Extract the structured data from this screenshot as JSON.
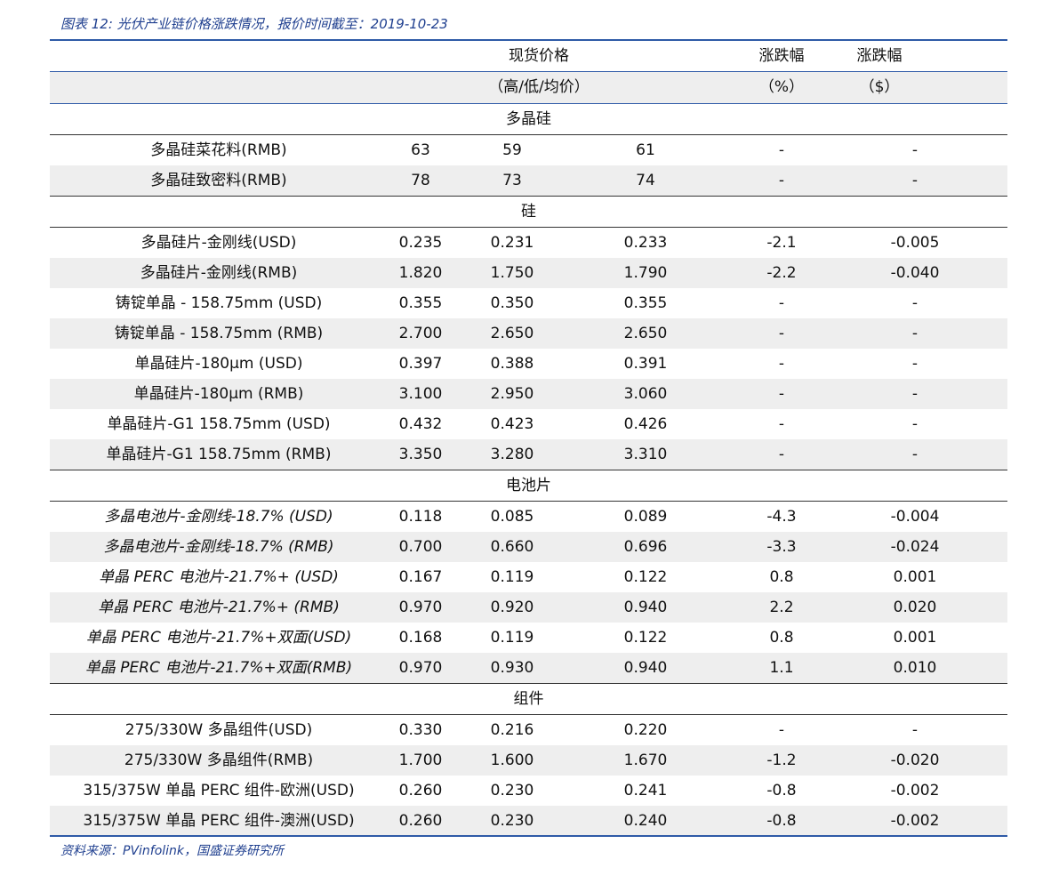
{
  "caption": "图表 12: 光伏产业链价格涨跌情况，报价时间截至：2019-10-23",
  "header": {
    "spot_price": "现货价格",
    "change1": "涨跌幅",
    "change2": "涨跌幅",
    "hl_avg": "（高/低/均价）",
    "pct": "（%）",
    "usd": "（$）"
  },
  "groups": [
    {
      "title": "多晶硅",
      "italic": false,
      "rows": [
        {
          "name": "多晶硅菜花料(RMB)",
          "high": "63",
          "low": "59",
          "avg": "61",
          "pct": "-",
          "abs": "-"
        },
        {
          "name": "多晶硅致密料(RMB)",
          "high": "78",
          "low": "73",
          "avg": "74",
          "pct": "-",
          "abs": "-"
        }
      ]
    },
    {
      "title": "硅",
      "italic": false,
      "rows": [
        {
          "name": "多晶硅片-金刚线(USD)",
          "high": "0.235",
          "low": "0.231",
          "avg": "0.233",
          "pct": "-2.1",
          "abs": "-0.005"
        },
        {
          "name": "多晶硅片-金刚线(RMB)",
          "high": "1.820",
          "low": "1.750",
          "avg": "1.790",
          "pct": "-2.2",
          "abs": "-0.040"
        },
        {
          "name": "铸锭单晶 - 158.75mm (USD)",
          "high": "0.355",
          "low": "0.350",
          "avg": "0.355",
          "pct": "-",
          "abs": "-"
        },
        {
          "name": "铸锭单晶 - 158.75mm (RMB)",
          "high": "2.700",
          "low": "2.650",
          "avg": "2.650",
          "pct": "-",
          "abs": "-"
        },
        {
          "name": "单晶硅片-180μm (USD)",
          "high": "0.397",
          "low": "0.388",
          "avg": "0.391",
          "pct": "-",
          "abs": "-"
        },
        {
          "name": "单晶硅片-180μm (RMB)",
          "high": "3.100",
          "low": "2.950",
          "avg": "3.060",
          "pct": "-",
          "abs": "-"
        },
        {
          "name": "单晶硅片-G1 158.75mm (USD)",
          "high": "0.432",
          "low": "0.423",
          "avg": "0.426",
          "pct": "-",
          "abs": "-"
        },
        {
          "name": "单晶硅片-G1 158.75mm (RMB)",
          "high": "3.350",
          "low": "3.280",
          "avg": "3.310",
          "pct": "-",
          "abs": "-"
        }
      ]
    },
    {
      "title": "电池片",
      "italic": true,
      "rows": [
        {
          "name": "多晶电池片-金刚线-18.7% (USD)",
          "high": "0.118",
          "low": "0.085",
          "avg": "0.089",
          "pct": "-4.3",
          "abs": "-0.004"
        },
        {
          "name": "多晶电池片-金刚线-18.7% (RMB)",
          "high": "0.700",
          "low": "0.660",
          "avg": "0.696",
          "pct": "-3.3",
          "abs": "-0.024"
        },
        {
          "name": "单晶 PERC 电池片-21.7%+ (USD)",
          "high": "0.167",
          "low": "0.119",
          "avg": "0.122",
          "pct": "0.8",
          "abs": "0.001"
        },
        {
          "name": "单晶 PERC 电池片-21.7%+ (RMB)",
          "high": "0.970",
          "low": "0.920",
          "avg": "0.940",
          "pct": "2.2",
          "abs": "0.020"
        },
        {
          "name": "单晶 PERC 电池片-21.7%+双面(USD)",
          "high": "0.168",
          "low": "0.119",
          "avg": "0.122",
          "pct": "0.8",
          "abs": "0.001"
        },
        {
          "name": "单晶 PERC 电池片-21.7%+双面(RMB)",
          "high": "0.970",
          "low": "0.930",
          "avg": "0.940",
          "pct": "1.1",
          "abs": "0.010"
        }
      ]
    },
    {
      "title": "组件",
      "italic": false,
      "rows": [
        {
          "name": "275/330W 多晶组件(USD)",
          "high": "0.330",
          "low": "0.216",
          "avg": "0.220",
          "pct": "-",
          "abs": "-"
        },
        {
          "name": "275/330W 多晶组件(RMB)",
          "high": "1.700",
          "low": "1.600",
          "avg": "1.670",
          "pct": "-1.2",
          "abs": "-0.020"
        },
        {
          "name": "315/375W 单晶 PERC 组件-欧洲(USD)",
          "high": "0.260",
          "low": "0.230",
          "avg": "0.241",
          "pct": "-0.8",
          "abs": "-0.002"
        },
        {
          "name": "315/375W 单晶 PERC 组件-澳洲(USD)",
          "high": "0.260",
          "low": "0.230",
          "avg": "0.240",
          "pct": "-0.8",
          "abs": "-0.002"
        }
      ]
    }
  ],
  "source": "资料来源：PVinfolink，国盛证券研究所"
}
